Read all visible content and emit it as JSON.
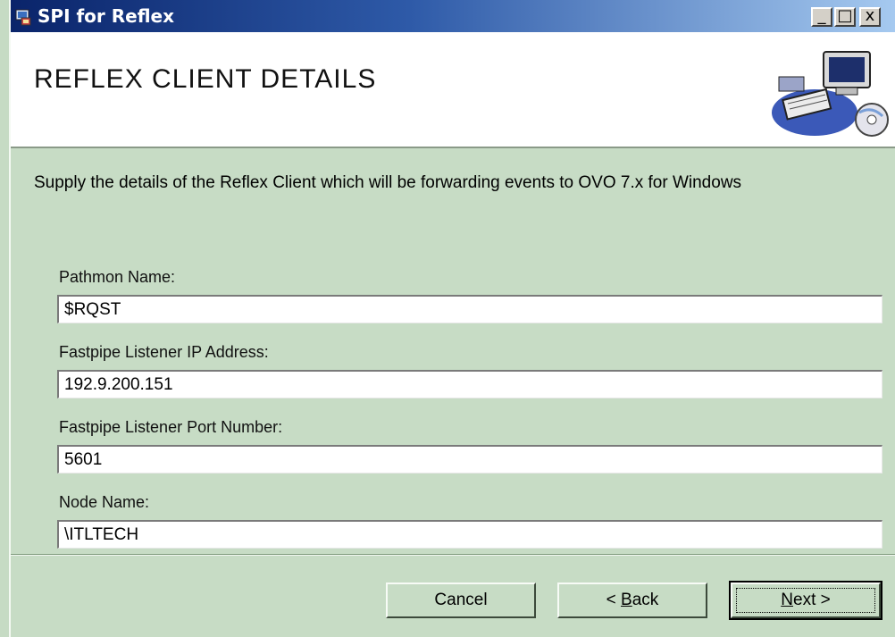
{
  "window": {
    "title": "SPI for Reflex",
    "controls": {
      "minimize": "_",
      "maximize": "□",
      "close": "x"
    }
  },
  "header": {
    "title": "REFLEX CLIENT DETAILS",
    "art_icon": "computer-with-cd-icon"
  },
  "description": "Supply the details of the Reflex Client which will be forwarding events to OVO 7.x for Windows",
  "fields": [
    {
      "label": "Pathmon Name:",
      "value": "$RQST"
    },
    {
      "label": "Fastpipe Listener IP Address:",
      "value": "192.9.200.151"
    },
    {
      "label": "Fastpipe Listener Port Number:",
      "value": "5601"
    },
    {
      "label": "Node Name:",
      "value": "\\ITLTECH"
    }
  ],
  "buttons": {
    "cancel": "Cancel",
    "back_prefix": "< ",
    "back_mnemonic": "B",
    "back_rest": "ack",
    "next_mnemonic": "N",
    "next_rest": "ext >"
  },
  "colors": {
    "background": "#c7dcc5",
    "titlebar_start": "#0a246a",
    "titlebar_end": "#a6caf0",
    "header_bg": "#ffffff"
  }
}
